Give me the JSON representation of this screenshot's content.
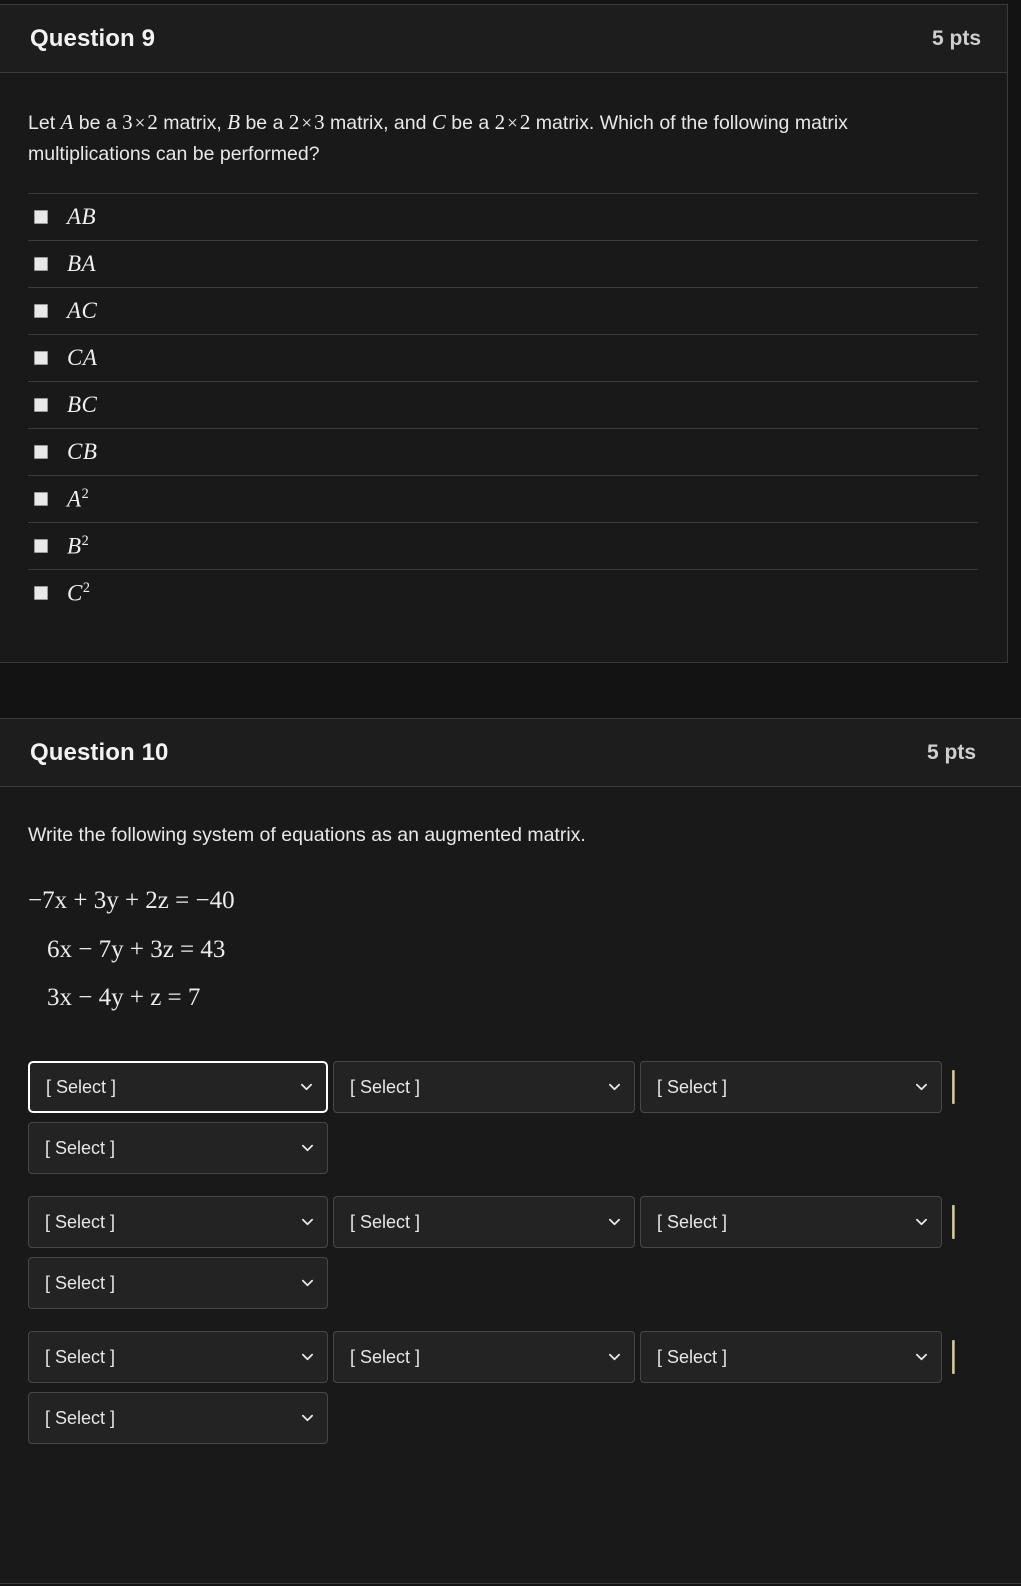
{
  "question9": {
    "title": "Question 9",
    "points": "5 pts",
    "prompt": {
      "segment1": "Let ",
      "var_a": "A",
      "segment2": " be a ",
      "dim1_rows": "3",
      "times1": "×",
      "dim1_cols": "2",
      "segment3": " matrix, ",
      "var_b": "B",
      "segment4": " be a ",
      "dim2_rows": "2",
      "times2": "×",
      "dim2_cols": "3",
      "segment5": " matrix, and ",
      "var_c": "C",
      "segment6": " be a ",
      "dim3_rows": "2",
      "times3": "×",
      "dim3_cols": "2",
      "segment7": " matrix. Which of the following matrix multiplications can be performed?"
    },
    "options": [
      {
        "label": "AB",
        "base": "AB",
        "sup": ""
      },
      {
        "label": "BA",
        "base": "BA",
        "sup": ""
      },
      {
        "label": "AC",
        "base": "AC",
        "sup": ""
      },
      {
        "label": "CA",
        "base": "CA",
        "sup": ""
      },
      {
        "label": "BC",
        "base": "BC",
        "sup": ""
      },
      {
        "label": "CB",
        "base": "CB",
        "sup": ""
      },
      {
        "label": "A2",
        "base": "A",
        "sup": "2"
      },
      {
        "label": "B2",
        "base": "B",
        "sup": "2"
      },
      {
        "label": "C2",
        "base": "C",
        "sup": "2"
      }
    ]
  },
  "question10": {
    "title": "Question 10",
    "points": "5 pts",
    "prompt": "Write the following system of equations as an augmented matrix.",
    "equations": [
      "−7x + 3y + 2z = −40",
      "6x − 7y + 3z = 43",
      "3x − 4y + z = 7"
    ],
    "select_placeholder": "[ Select ]",
    "matrix_rows": [
      {
        "cells": [
          "[ Select ]",
          "[ Select ]",
          "[ Select ]"
        ],
        "augment": "[ Select ]",
        "bar": "|"
      },
      {
        "cells": [
          "[ Select ]",
          "[ Select ]",
          "[ Select ]"
        ],
        "augment": "[ Select ]",
        "bar": "|"
      },
      {
        "cells": [
          "[ Select ]",
          "[ Select ]",
          "[ Select ]"
        ],
        "augment": "[ Select ]",
        "bar": "|"
      }
    ]
  },
  "colors": {
    "page_background": "#131313",
    "card_background": "#191919",
    "header_background": "#1d1d1d",
    "border": "#3a3a3a",
    "text_primary": "#e8e8e8",
    "select_background": "#232323",
    "focus_ring": "#ffffff",
    "augment_bar": "#d9d2a3"
  }
}
